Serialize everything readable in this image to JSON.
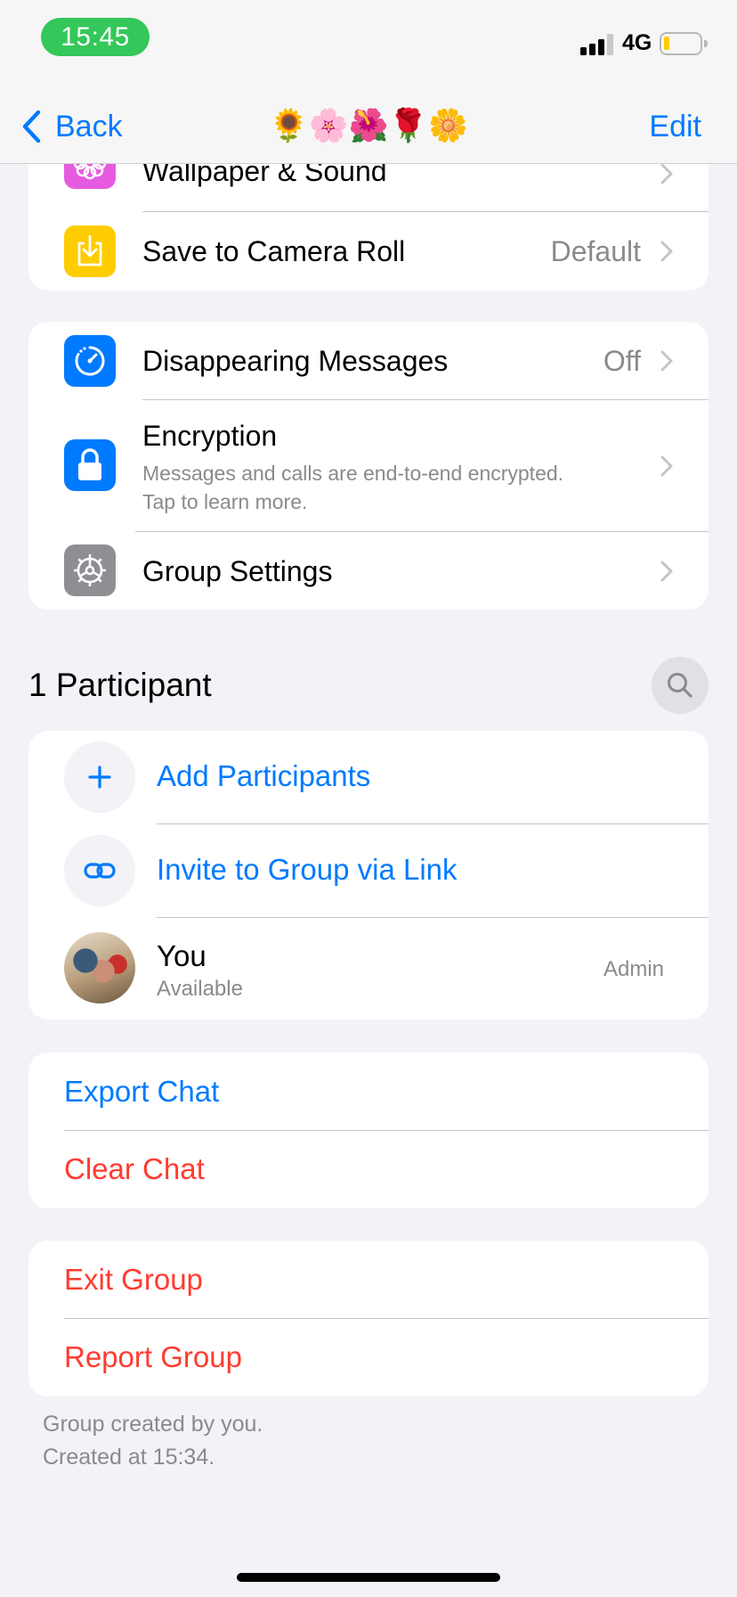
{
  "status_bar": {
    "time": "15:45",
    "network": "4G",
    "signal_bars_filled": 3,
    "signal_bars_total": 4,
    "battery_level": 0.15,
    "colors": {
      "time_pill": "#34c759",
      "battery_fill": "#ffcc00"
    }
  },
  "nav": {
    "back_label": "Back",
    "title": "🌻🌸🌺🌹🌼",
    "edit_label": "Edit"
  },
  "settings_group_1": {
    "wallpaper_label": "Wallpaper & Sound",
    "save_camera_roll_label": "Save to Camera Roll",
    "save_camera_roll_value": "Default"
  },
  "settings_group_2": {
    "disappearing_label": "Disappearing Messages",
    "disappearing_value": "Off",
    "encryption_label": "Encryption",
    "encryption_line1": "Messages and calls are end-to-end encrypted.",
    "encryption_line2": "Tap to learn more.",
    "group_settings_label": "Group Settings"
  },
  "participants": {
    "header": "1 Participant",
    "add_label": "Add Participants",
    "invite_label": "Invite to Group via Link",
    "members": [
      {
        "name": "You",
        "status": "Available",
        "role": "Admin"
      }
    ]
  },
  "chat_actions": {
    "export_label": "Export Chat",
    "clear_label": "Clear Chat"
  },
  "group_actions": {
    "exit_label": "Exit Group",
    "report_label": "Report Group"
  },
  "footer": {
    "line1": "Group created by you.",
    "line2": "Created at 15:34."
  },
  "colors": {
    "accent": "#007aff",
    "destructive": "#ff3b30",
    "wallpaper_icon_bg": "#e65be0",
    "camera_roll_icon_bg": "#ffcc00",
    "disappearing_icon_bg": "#007aff",
    "encryption_icon_bg": "#007aff",
    "group_settings_icon_bg": "#8e8e93"
  }
}
